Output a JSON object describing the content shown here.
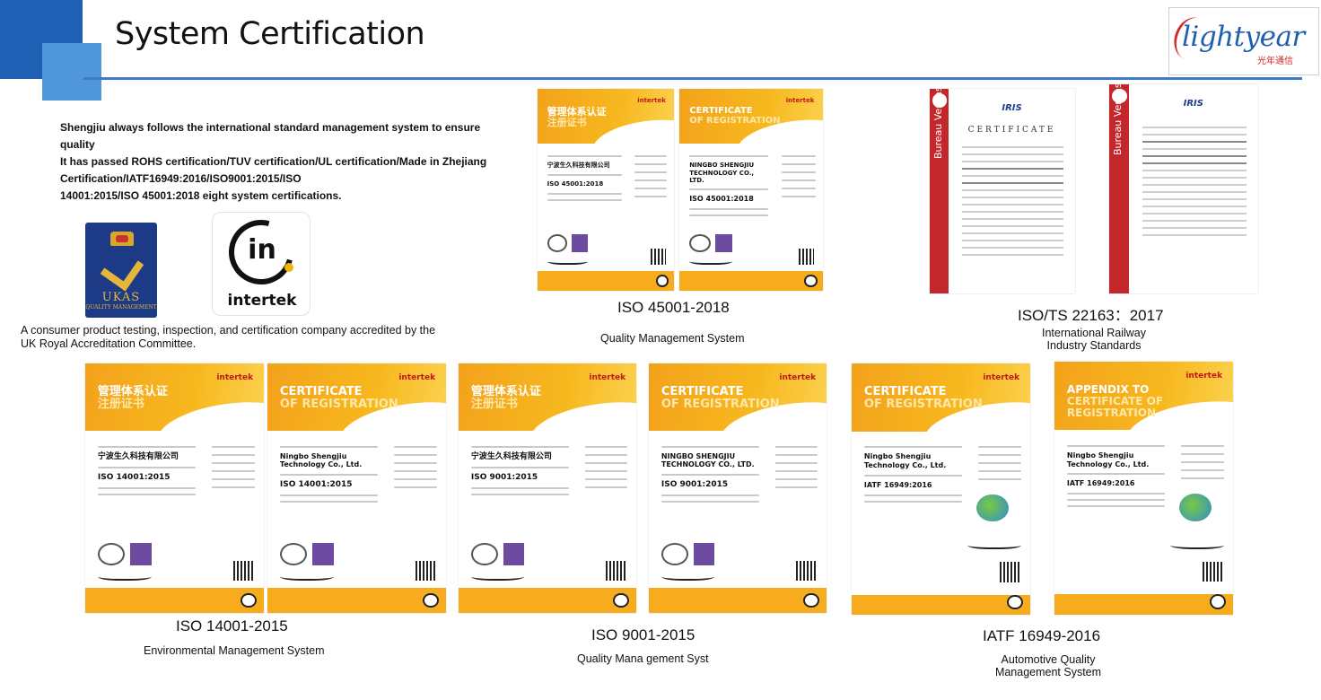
{
  "page": {
    "title": "System Certification",
    "accent_color": "#1f5fb4",
    "accent_light": "#4f97d8"
  },
  "logo": {
    "brand": "lightyear",
    "brand_cn": "光年通信"
  },
  "intro": {
    "lines": [
      "Shengjiu always follows the international standard management system to ensure quality",
      "It has passed ROHS certification/TUV certification/UL certification/Made in Zhejiang",
      "Certification/IATF16949:2016/ISO9001:2015/ISO",
      "14001:2015/ISO 45001:2018 eight system certifications."
    ]
  },
  "accreditation": {
    "ukas_word": "UKAS",
    "ukas_sub": "QUALITY MANAGEMENT",
    "intertek_word": "intertek",
    "description_lines": [
      "A consumer product testing, inspection, and certification company accredited by the",
      "UK Royal Accreditation Committee."
    ]
  },
  "certificates": {
    "iso45001": {
      "code": "ISO 45001-2018",
      "name": "Quality Management System",
      "doc_cn": {
        "head1": "管理体系认证",
        "head2": "注册证书",
        "brand": "intertek",
        "company": "宁波生久科技有限公司",
        "std": "ISO 45001:2018"
      },
      "doc_en": {
        "head1": "CERTIFICATE",
        "head2": "OF REGISTRATION",
        "brand": "intertek",
        "company": "NINGBO SHENGJIU TECHNOLOGY CO., LTD.",
        "std": "ISO 45001:2018"
      }
    },
    "iris": {
      "code": "ISO/TS 22163：2017",
      "name_lines": [
        "International Railway",
        "Industry Standards"
      ],
      "doc1": {
        "strip": "Bureau Veritas Certification",
        "iris": "IRIS",
        "cert": "CERTIFICATE"
      },
      "doc2": {
        "strip": "Bureau Veritas Certification",
        "iris": "IRIS"
      }
    },
    "iso14001": {
      "code": "ISO 14001-2015",
      "name": "Environmental Management System",
      "doc_cn": {
        "head1": "管理体系认证",
        "head2": "注册证书",
        "brand": "intertek",
        "company": "宁波生久科技有限公司",
        "std": "ISO 14001:2015"
      },
      "doc_en": {
        "head1": "CERTIFICATE",
        "head2": "OF REGISTRATION",
        "brand": "intertek",
        "company": "Ningbo Shengjiu Technology Co., Ltd.",
        "std": "ISO 14001:2015"
      }
    },
    "iso9001": {
      "code": "ISO 9001-2015",
      "name": "Quality Mana gement Syst",
      "doc_cn": {
        "head1": "管理体系认证",
        "head2": "注册证书",
        "brand": "intertek",
        "company": "宁波生久科技有限公司",
        "std": "ISO 9001:2015"
      },
      "doc_en": {
        "head1": "CERTIFICATE",
        "head2": "OF REGISTRATION",
        "brand": "intertek",
        "company": "NINGBO SHENGJIU TECHNOLOGY CO., LTD.",
        "std": "ISO 9001:2015"
      }
    },
    "iatf": {
      "code": "IATF 16949-2016",
      "name_lines": [
        "Automotive Quality",
        "Management System"
      ],
      "doc1": {
        "head1": "CERTIFICATE",
        "head2": "OF REGISTRATION",
        "brand": "intertek",
        "company": "Ningbo Shengjiu Technology Co., Ltd.",
        "std": "IATF 16949:2016"
      },
      "doc2": {
        "head1": "APPENDIX TO",
        "head2": "CERTIFICATE OF REGISTRATION",
        "brand": "intertek",
        "company": "Ningbo Shengjiu Technology Co., Ltd.",
        "std": "IATF 16949:2016"
      }
    }
  }
}
